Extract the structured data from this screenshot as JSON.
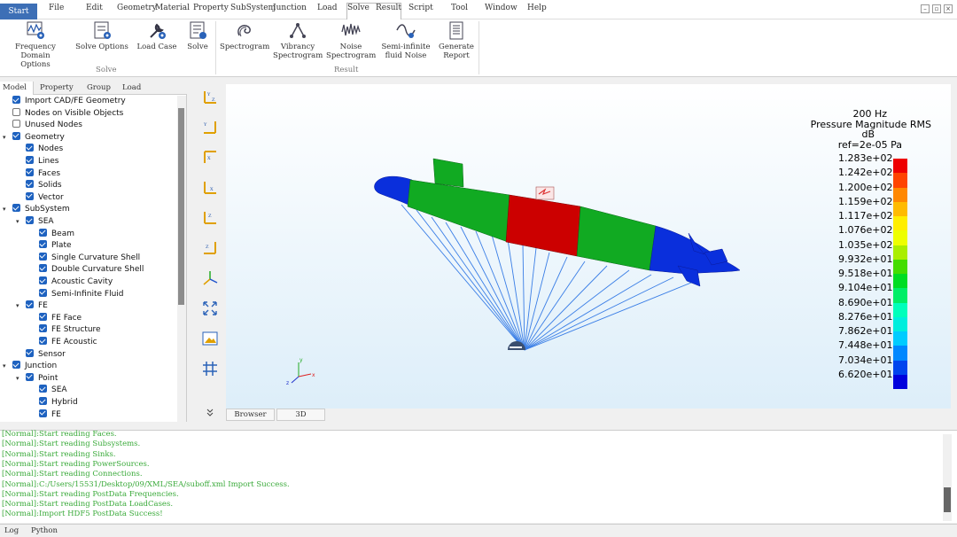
{
  "menu": {
    "start": "Start",
    "items": [
      "File",
      "Edit",
      "Geometry",
      "Material",
      "Property",
      "SubSystem",
      "Junction",
      "Load",
      "Solve",
      "Result",
      "Script",
      "Tool",
      "Window",
      "Help"
    ]
  },
  "ribbon": {
    "solve_group": {
      "label": "Solve",
      "buttons": [
        {
          "label": "Frequency Domain\nOptions",
          "icon": "frequency-domain-icon"
        },
        {
          "label": "Solve Options",
          "icon": "solve-options-icon"
        },
        {
          "label": "Load Case",
          "icon": "load-case-icon"
        },
        {
          "label": "Solve",
          "icon": "solve-icon"
        }
      ]
    },
    "result_group": {
      "label": "Result",
      "buttons": [
        {
          "label": "Spectrogram",
          "icon": "spectrogram-icon"
        },
        {
          "label": "Vibrancy\nSpectrogram",
          "icon": "vibrancy-spectrogram-icon"
        },
        {
          "label": "Noise\nSpectrogram",
          "icon": "noise-spectrogram-icon"
        },
        {
          "label": "Semi-infinite\nfluid Noise",
          "icon": "semi-infinite-noise-icon"
        },
        {
          "label": "Generate\nReport",
          "icon": "generate-report-icon"
        }
      ]
    }
  },
  "panel_tabs": [
    "Model",
    "Property",
    "Group",
    "Load"
  ],
  "tree": [
    {
      "label": "Import CAD/FE Geometry",
      "checked": true
    },
    {
      "label": "Nodes on Visible Objects",
      "checked": false
    },
    {
      "label": "Unused Nodes",
      "checked": false
    },
    {
      "label": "Geometry",
      "checked": true
    },
    {
      "label": "Nodes",
      "checked": true
    },
    {
      "label": "Lines",
      "checked": true
    },
    {
      "label": "Faces",
      "checked": true
    },
    {
      "label": "Solids",
      "checked": true
    },
    {
      "label": "Vector",
      "checked": true
    },
    {
      "label": "SubSystem",
      "checked": true
    },
    {
      "label": "SEA",
      "checked": true
    },
    {
      "label": "Beam",
      "checked": true
    },
    {
      "label": "Plate",
      "checked": true
    },
    {
      "label": "Single Curvature Shell",
      "checked": true
    },
    {
      "label": "Double Curvature Shell",
      "checked": true
    },
    {
      "label": "Acoustic Cavity",
      "checked": true
    },
    {
      "label": "Semi-Infinite Fluid",
      "checked": true
    },
    {
      "label": "FE",
      "checked": true
    },
    {
      "label": "FE Face",
      "checked": true
    },
    {
      "label": "FE Structure",
      "checked": true
    },
    {
      "label": "FE Acoustic",
      "checked": true
    },
    {
      "label": "Sensor",
      "checked": true
    },
    {
      "label": "Junction",
      "checked": true
    },
    {
      "label": "Point",
      "checked": true
    },
    {
      "label": "SEA",
      "checked": true
    },
    {
      "label": "Hybrid",
      "checked": true
    },
    {
      "label": "FE",
      "checked": true
    }
  ],
  "legend": {
    "title_lines": [
      "200 Hz",
      "Pressure Magnitude RMS",
      "dB",
      "ref=2e-05 Pa"
    ],
    "values": [
      "1.283e+02",
      "1.242e+02",
      "1.200e+02",
      "1.159e+02",
      "1.117e+02",
      "1.076e+02",
      "1.035e+02",
      "9.932e+01",
      "9.518e+01",
      "9.104e+01",
      "8.690e+01",
      "8.276e+01",
      "7.862e+01",
      "7.448e+01",
      "7.034e+01",
      "6.620e+01"
    ],
    "colors": [
      "#ee0000",
      "#ff4400",
      "#ff8800",
      "#ffbb00",
      "#ffee00",
      "#eeff00",
      "#aaee00",
      "#44dd00",
      "#00dd22",
      "#00ee66",
      "#00ffbb",
      "#00eedd",
      "#00ccff",
      "#0088ff",
      "#0044ee",
      "#0000dd"
    ]
  },
  "axis_labels": {
    "x": "x",
    "y": "y",
    "z": "z"
  },
  "view_tabs": [
    "Browser",
    "3D"
  ],
  "log": [
    "[Normal]:Start reading Faces.",
    "[Normal]:Start reading Subsystems.",
    "[Normal]:Start reading Sinks.",
    "[Normal]:Start reading PowerSources.",
    "[Normal]:Start reading Connections.",
    "[Normal]:C:/Users/15531/Desktop/09/XML/SEA/suboff.xml Import Success.",
    "[Normal]:Start reading PostData Frequencies.",
    "[Normal]:Start reading PostData LoadCases.",
    "[Normal]:Import HDF5 PostData Success!"
  ],
  "bottom_tabs": [
    "Log",
    "Python"
  ],
  "colors": {
    "accent": "#3d6fb6",
    "hull_blue": "#0a2fdc",
    "hull_green": "#11aa22",
    "hull_red": "#cc0000",
    "log_text": "#3aaa3a"
  }
}
